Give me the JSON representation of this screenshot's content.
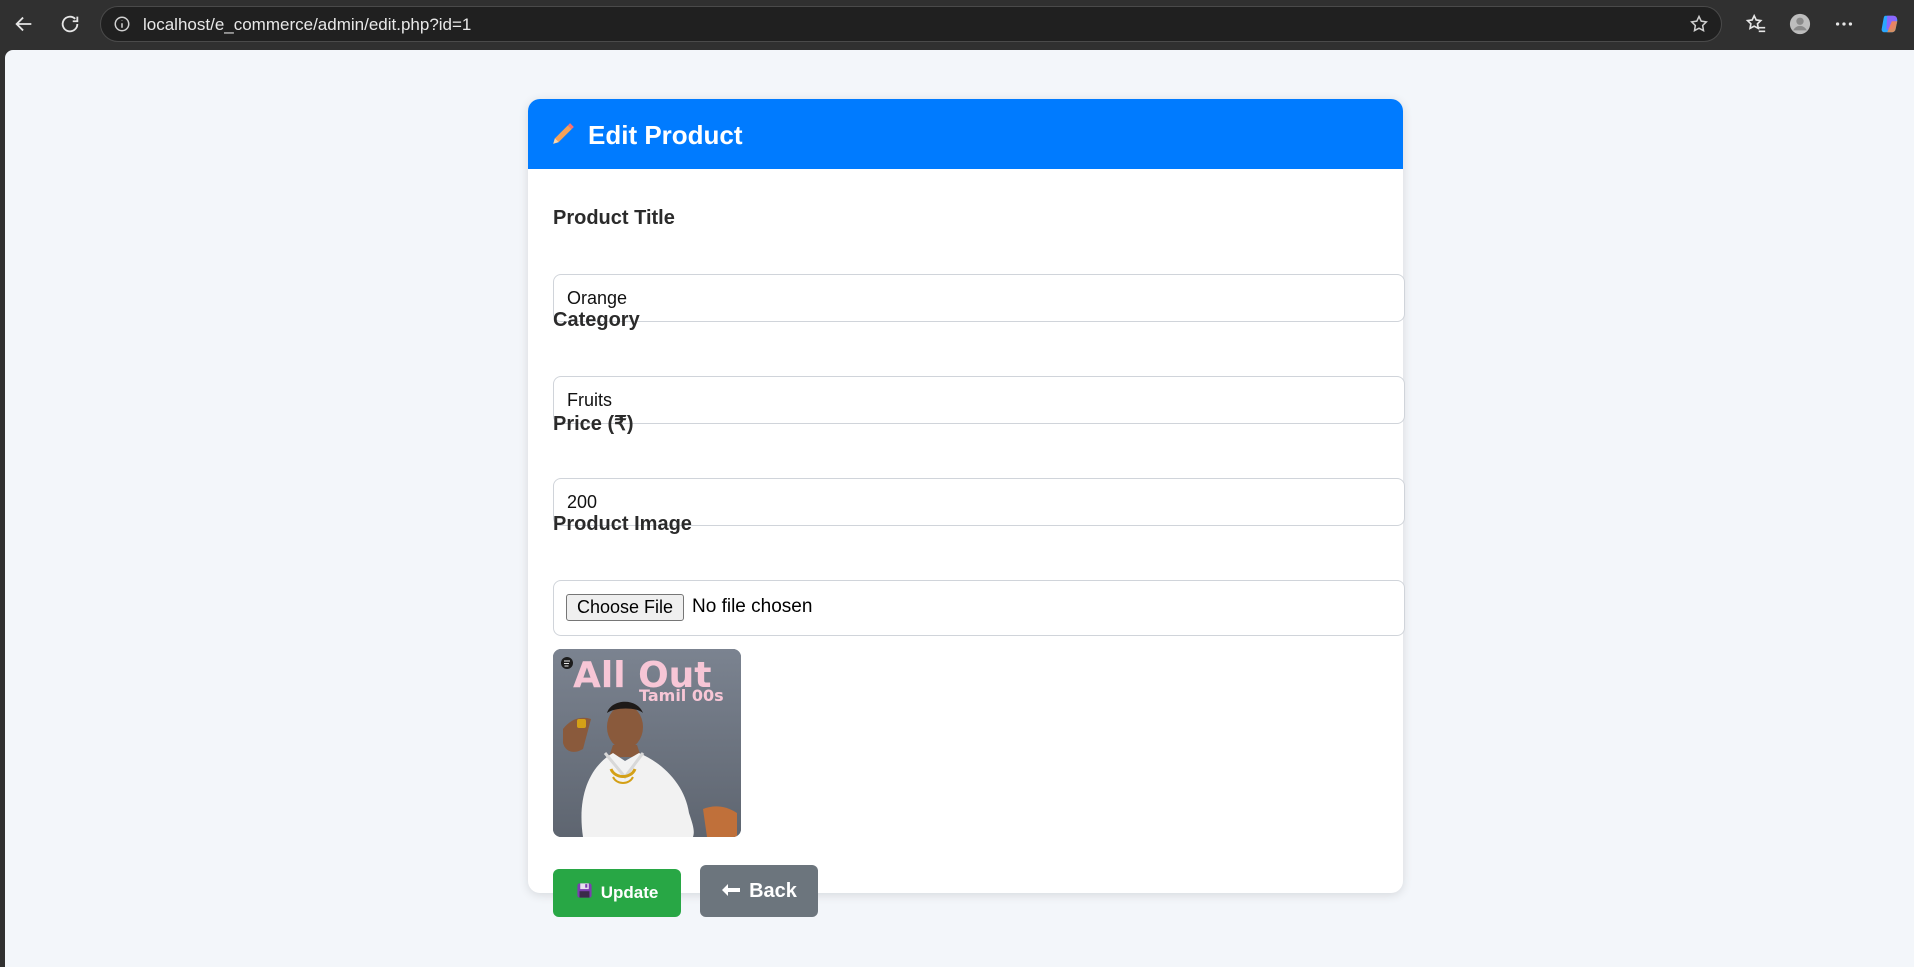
{
  "browser": {
    "url": "localhost/e_commerce/admin/edit.php?id=1"
  },
  "form": {
    "heading": "Edit Product",
    "fields": [
      {
        "label": "Product Title",
        "value": "Orange"
      },
      {
        "label": "Category",
        "value": "Fruits"
      },
      {
        "label": "Price (₹)",
        "value": "200"
      }
    ],
    "image": {
      "label": "Product Image",
      "choose_label": "Choose File",
      "status": "No file chosen",
      "preview_title": "All Out",
      "preview_subtitle": "Tamil 00s"
    },
    "buttons": {
      "update": "Update",
      "back": "Back"
    }
  },
  "colors": {
    "header": "#007bff",
    "update": "#28a745",
    "back": "#6c757d",
    "page_bg": "#f3f6fa"
  }
}
